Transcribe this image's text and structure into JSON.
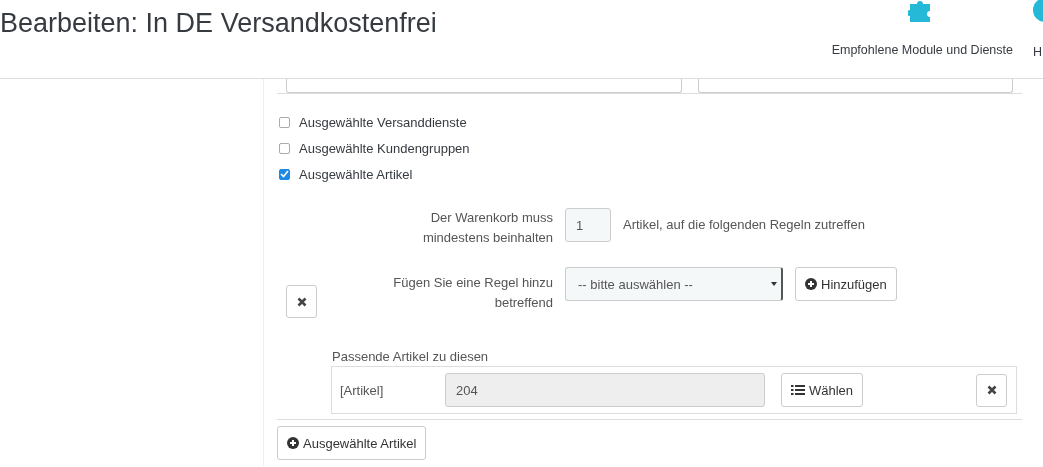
{
  "header": {
    "title": "Bearbeiten: In DE Versandkostenfrei",
    "toolbar": [
      {
        "kind": "puzzle",
        "label": "Empfohlene Module und Dienste"
      },
      {
        "kind": "help",
        "label": "H"
      }
    ]
  },
  "conditions": [
    {
      "label": "Ausgewählte Versanddienste",
      "checked": false
    },
    {
      "label": "Ausgewählte Kundengruppen",
      "checked": false
    },
    {
      "label": "Ausgewählte Artikel",
      "checked": true
    }
  ],
  "quantity_rule": {
    "label": "Der Warenkorb muss mindestens beinhalten",
    "value": "1",
    "suffix": "Artikel, auf die folgenden Regeln zutreffen"
  },
  "add_rule": {
    "label": "Fügen Sie eine Regel hinzu betreffend",
    "select": "-- bitte auswählen --",
    "button": "Hinzufügen"
  },
  "rule_group": {
    "title": "Passende Artikel zu diesen",
    "rows": [
      {
        "label": "[Artikel]",
        "value": "204",
        "button": "Wählen"
      }
    ]
  },
  "add_group_button": "Ausgewählte Artikel"
}
